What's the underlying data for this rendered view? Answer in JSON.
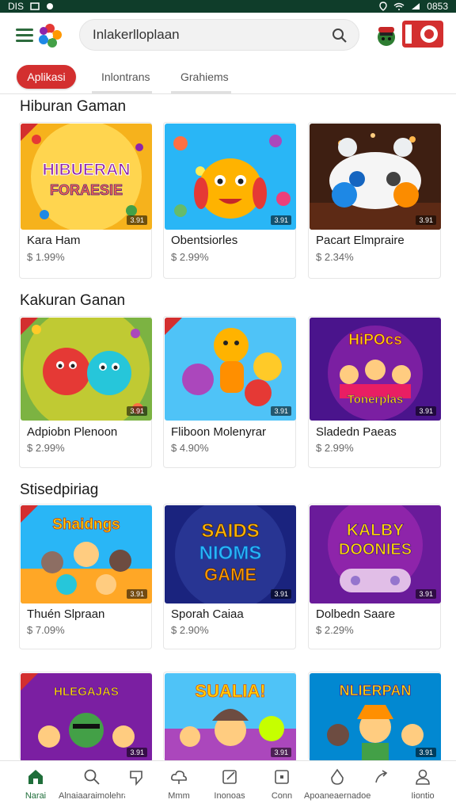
{
  "status_bar": {
    "left_text": "DIS",
    "time": "0853"
  },
  "search": {
    "query": "Inlakerlloplaan"
  },
  "tabs": [
    {
      "label": "Aplikasi"
    },
    {
      "label": "Inlontrans"
    },
    {
      "label": "Grahiems"
    }
  ],
  "sections": [
    {
      "title": "Hiburan Gaman",
      "items": [
        {
          "name": "Kara Ham",
          "price": "$ 1.99%",
          "rating": "3.91",
          "art": "HIBURAN FORAESIE"
        },
        {
          "name": "Obentsiorles",
          "price": "$ 2.99%",
          "rating": "3.91",
          "art": ""
        },
        {
          "name": "Pacart Elmpraire",
          "price": "$ 2.34%",
          "rating": "3.91",
          "art": ""
        }
      ]
    },
    {
      "title": "Kakuran Ganan",
      "items": [
        {
          "name": "Adpiobn Plenoon",
          "price": "$ 2.99%",
          "rating": "3.91",
          "art": ""
        },
        {
          "name": "Fliboon Molenyrar",
          "price": "$ 4.90%",
          "rating": "3.91",
          "art": ""
        },
        {
          "name": "Sladedn Paeas",
          "price": "$ 2.99%",
          "rating": "3.91",
          "art": "HiPOcs Tonerplas"
        }
      ]
    },
    {
      "title": "Stisedpiriag",
      "items": [
        {
          "name": "Thuén Slpraan",
          "price": "$ 7.09%",
          "rating": "3.91",
          "art": "Shaidngs"
        },
        {
          "name": "Sporah Caiaa",
          "price": "$ 2.90%",
          "rating": "3.91",
          "art": "SAIDS NIOMS GAME"
        },
        {
          "name": "Dolbedn Saare",
          "price": "$ 2.29%",
          "rating": "3.91",
          "art": "KALBY DOONIES"
        }
      ]
    },
    {
      "title": "",
      "items": [
        {
          "name": "",
          "price": "",
          "rating": "3.91",
          "art": "HLEGAJAS"
        },
        {
          "name": "",
          "price": "",
          "rating": "3.91",
          "art": "SUALIA!"
        },
        {
          "name": "",
          "price": "",
          "rating": "3.91",
          "art": "NLIERPAN"
        }
      ]
    }
  ],
  "bottom_nav": [
    {
      "label": "Narai",
      "icon": "home-icon"
    },
    {
      "label": "Alnaiaaraimolehran",
      "icon": "search-icon"
    },
    {
      "label": "Mmm",
      "icon": "heart-icon"
    },
    {
      "label": "Inonoas",
      "icon": "cloud-icon"
    },
    {
      "label": "Conn",
      "icon": "edit-icon"
    },
    {
      "label": "",
      "icon": "square-icon"
    },
    {
      "label": "Apoaneaernadoen",
      "icon": "drop-icon"
    },
    {
      "label": "Iiontio",
      "icon": "share-icon"
    },
    {
      "label": "",
      "icon": "user-icon"
    }
  ],
  "colors": {
    "accent": "#d32f2f",
    "brand_green": "#1f6e3a",
    "status_bar": "#0f3d2a"
  }
}
